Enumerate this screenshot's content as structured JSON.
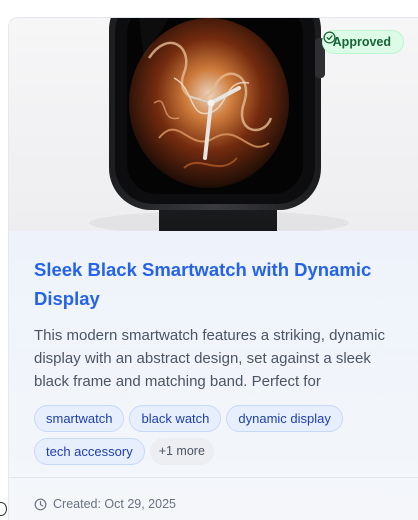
{
  "badge": {
    "label": "Approved",
    "icon": "check-circle-icon",
    "color": "#166534"
  },
  "product": {
    "image_alt": "smartwatch-image",
    "title": "Sleek Black Smartwatch with Dynamic Display",
    "description": "This modern smartwatch features a striking, dynamic display with an abstract design, set against a sleek black frame and matching band. Perfect for",
    "tags": [
      "smartwatch",
      "black watch",
      "dynamic display",
      "tech accessory"
    ],
    "more_tags": "+1 more"
  },
  "footer": {
    "icon": "clock-icon",
    "created": "Created: Oct 29, 2025"
  },
  "colors": {
    "title": "#2563eb",
    "tag_text": "#1e40af",
    "badge_bg": "#dcfce7"
  }
}
